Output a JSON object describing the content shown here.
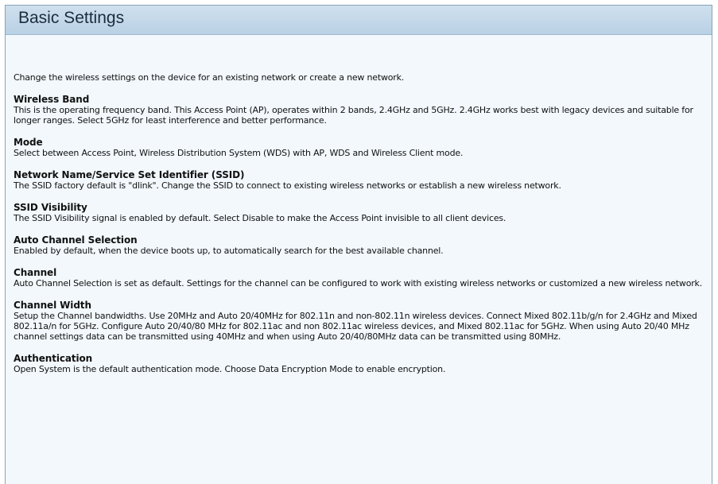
{
  "panel": {
    "title": "Basic Settings"
  },
  "intro": "Change the wireless settings on the device for an existing network or create a new network.",
  "sections": [
    {
      "title": "Wireless Band",
      "description": "This is the operating frequency band. This Access Point (AP), operates within 2 bands, 2.4GHz and 5GHz. 2.4GHz works best with legacy devices and suitable for longer ranges. Select 5GHz for least interference and better performance."
    },
    {
      "title": "Mode",
      "description": "Select between Access Point, Wireless Distribution System (WDS) with AP, WDS and Wireless Client mode."
    },
    {
      "title": "Network Name/Service Set Identifier (SSID)",
      "description": "The SSID factory default is \"dlink\". Change the SSID to connect to existing wireless networks or establish a new wireless network."
    },
    {
      "title": "SSID Visibility",
      "description": "The SSID Visibility signal is enabled by default. Select Disable to make the Access Point invisible to all client devices."
    },
    {
      "title": "Auto Channel Selection",
      "description": "Enabled by default, when the device boots up, to automatically search for the best available channel."
    },
    {
      "title": "Channel",
      "description": "Auto Channel Selection is set as default. Settings for the channel can be configured to work with existing wireless networks or customized a new wireless network."
    },
    {
      "title": "Channel Width",
      "description": "Setup the Channel bandwidths. Use 20MHz and Auto 20/40MHz for 802.11n and non-802.11n wireless devices. Connect Mixed 802.11b/g/n for 2.4GHz and Mixed 802.11a/n for 5GHz. Configure Auto 20/40/80 MHz for 802.11ac and non 802.11ac wireless devices, and Mixed 802.11ac for 5GHz. When using Auto 20/40 MHz channel settings data can be transmitted using 40MHz and when using Auto 20/40/80MHz data can be transmitted using 80MHz."
    },
    {
      "title": "Authentication",
      "description": "Open System is the default authentication mode. Choose Data Encryption Mode to enable encryption."
    }
  ]
}
